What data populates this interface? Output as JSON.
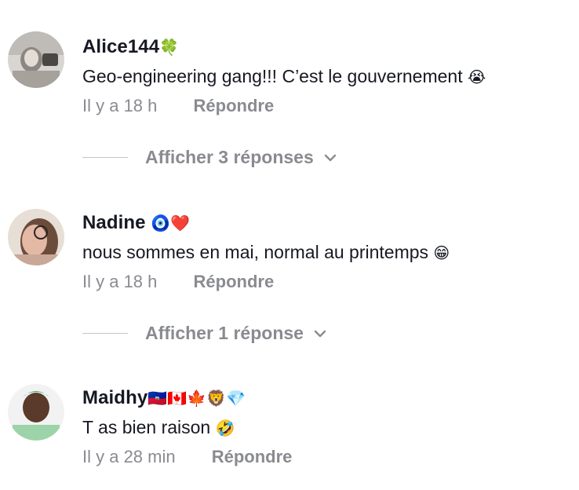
{
  "comments": [
    {
      "username": "Alice144",
      "badges": "🍀",
      "text": "Geo-engineering gang!!! C’est le gouvernement",
      "text_emoji": "😭",
      "time": "Il y a 18 h",
      "reply_label": "Répondre",
      "replies_label": "Afficher 3 réponses"
    },
    {
      "username": "Nadine",
      "badges": "🧿❤️",
      "text": "nous sommes en mai, normal au printemps",
      "text_emoji": "😁",
      "time": "Il y a 18 h",
      "reply_label": "Répondre",
      "replies_label": "Afficher 1 réponse"
    },
    {
      "username": "Maidhy",
      "badges": "🇭🇹🇨🇦🍁🦁💎",
      "text": "T as bien raison",
      "text_emoji": "🤣",
      "time": "Il y a 28 min",
      "reply_label": "Répondre"
    }
  ],
  "colors": {
    "text": "#161823",
    "secondary": "#8a8b91",
    "divider": "#c6c6c9"
  }
}
